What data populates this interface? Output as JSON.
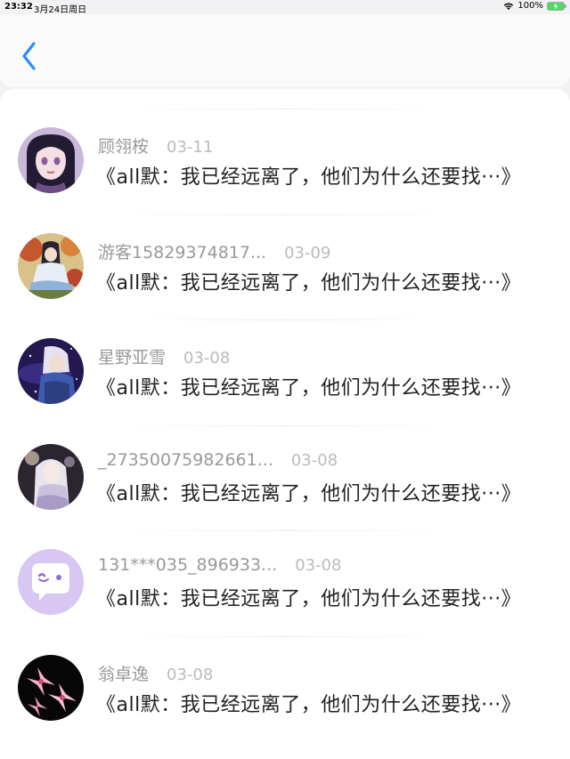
{
  "status_bar": {
    "time": "23:32",
    "date": "3月24日周日",
    "battery": "100%"
  },
  "nav": {
    "back_icon": "chevron-left-icon",
    "accent_color": "#2a8ef5"
  },
  "items": [
    {
      "username": "顾翎桉",
      "date": "03-11",
      "title": "《all默：我已经远离了，他们为什么还要找···》",
      "avatar": "anime-girl-dark-hair"
    },
    {
      "username": "游客15829374817...",
      "date": "03-09",
      "title": "《all默：我已经远离了，他们为什么还要找···》",
      "avatar": "anime-figure-autumn"
    },
    {
      "username": "星野亚雪",
      "date": "03-08",
      "title": "《all默：我已经远离了，他们为什么还要找···》",
      "avatar": "anime-boy-galaxy"
    },
    {
      "username": "_27350075982661...",
      "date": "03-08",
      "title": "《all默：我已经远离了，他们为什么还要找···》",
      "avatar": "anime-figure-white-hair"
    },
    {
      "username": "131***035_896933...",
      "date": "03-08",
      "title": "《all默：我已经远离了，他们为什么还要找···》",
      "avatar": "chat-bubble-default"
    },
    {
      "username": "翁卓逸",
      "date": "03-08",
      "title": "《all默：我已经远离了，他们为什么还要找···》",
      "avatar": "pink-lily-flowers"
    }
  ]
}
